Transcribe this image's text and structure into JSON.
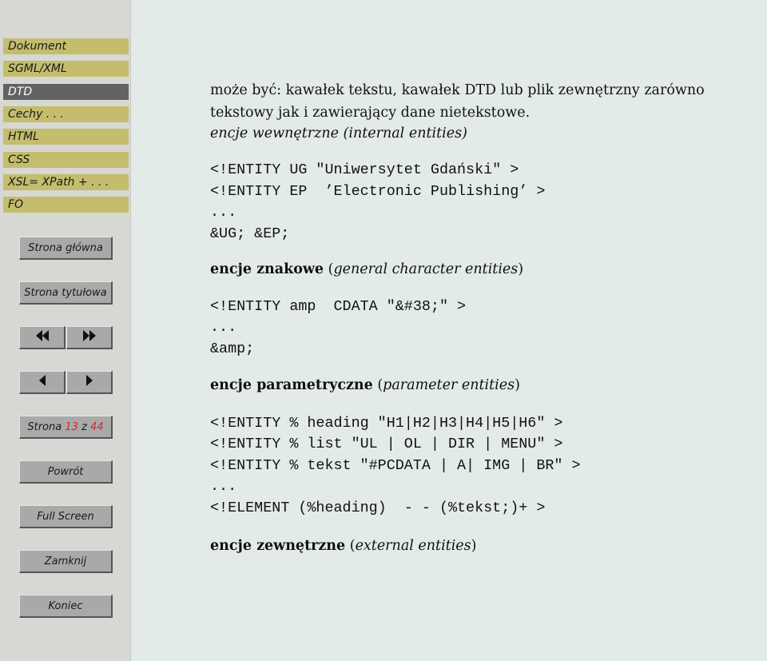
{
  "sidebar": {
    "nav_items": [
      {
        "label": "Dokument",
        "active": false
      },
      {
        "label": "SGML/XML",
        "active": false
      },
      {
        "label": "DTD",
        "active": true
      },
      {
        "label": "Cechy . . .",
        "active": false
      },
      {
        "label": "HTML",
        "active": false
      },
      {
        "label": "CSS",
        "active": false
      },
      {
        "label": "XSL= XPath + . . .",
        "active": false
      },
      {
        "label": "FO",
        "active": false
      }
    ],
    "buttons": {
      "home": "Strona główna",
      "title_page": "Strona tytułowa",
      "page_prefix": "Strona",
      "page_current": "13",
      "page_sep": "z",
      "page_total": "44",
      "back": "Powrót",
      "full_screen": "Full Screen",
      "close": "Zamknij",
      "end": "Koniec"
    },
    "icons": {
      "first": "double-left-triangle",
      "last": "double-right-triangle",
      "prev": "left-triangle",
      "next": "right-triangle"
    },
    "colors": {
      "nav_bg": "#c3bd6d",
      "nav_active_bg": "#626262",
      "page_number": "#d9262b"
    }
  },
  "content": {
    "intro_line1": "może być: kawałek tekstu, kawałek DTD lub plik zewnętrzny zarówno",
    "intro_line2": "tekstowy jak i zawierający dane nietekstowe.",
    "internal": {
      "term": "encje wewnętrzne",
      "en": "internal entities"
    },
    "internal_code": [
      "<!ENTITY UG \"Uniwersytet Gdański\" >",
      "<!ENTITY EP  ’Electronic Publishing’ >",
      "...",
      "&UG; &EP;"
    ],
    "general": {
      "term": "encje znakowe",
      "en": "general character entities"
    },
    "general_code": [
      "<!ENTITY amp  CDATA \"&#38;\" >",
      "...",
      "&amp;"
    ],
    "parameter": {
      "term": "encje parametryczne",
      "en": "parameter entities"
    },
    "parameter_code": [
      "<!ENTITY % heading \"H1|H2|H3|H4|H5|H6\" >",
      "<!ENTITY % list \"UL | OL | DIR | MENU\" >",
      "<!ENTITY % tekst \"#PCDATA | A| IMG | BR\" >",
      "...",
      "<!ELEMENT (%heading)  - - (%tekst;)+ >"
    ],
    "external": {
      "term": "encje zewnętrzne",
      "en": "external entities"
    }
  }
}
